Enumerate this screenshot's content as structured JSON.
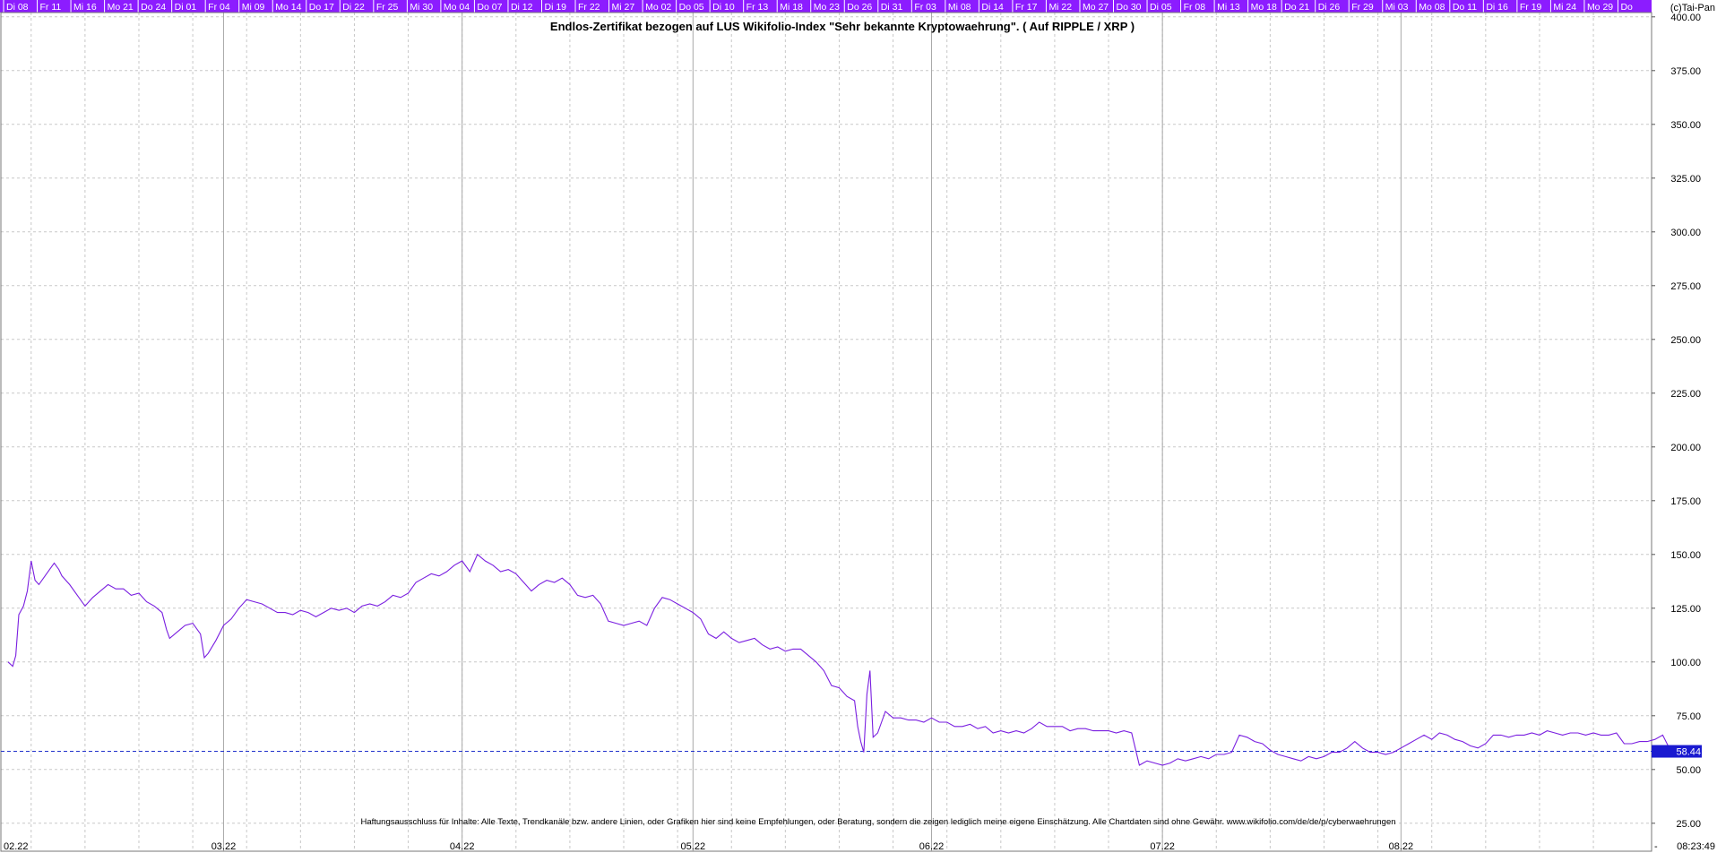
{
  "copyright": "(c)Tai-Pan",
  "timestamp": "08:23:49",
  "footer_dash": "-",
  "top_day_labels": [
    "Di 08",
    "Fr 11",
    "Mi 16",
    "Mo 21",
    "Do 24",
    "Di 01",
    "Fr 04",
    "Mi 09",
    "Mo 14",
    "Do 17",
    "Di 22",
    "Fr 25",
    "Mi 30",
    "Mo 04",
    "Do 07",
    "Di 12",
    "Di 19",
    "Fr 22",
    "Mi 27",
    "Mo 02",
    "Do 05",
    "Di 10",
    "Fr 13",
    "Mi 18",
    "Mo 23",
    "Do 26",
    "Di 31",
    "Fr 03",
    "Mi 08",
    "Di 14",
    "Fr 17",
    "Mi 22",
    "Mo 27",
    "Do 30",
    "Di 05",
    "Fr 08",
    "Mi 13",
    "Mo 18",
    "Do 21",
    "Di 26",
    "Fr 29",
    "Mi 03",
    "Mo 08",
    "Do 11",
    "Di 16",
    "Fr 19",
    "Mi 24",
    "Mo 29",
    "Do"
  ],
  "colors": {
    "series": "#7a1fe0",
    "header_bg": "#8c1cff",
    "header_text": "#ffffff",
    "current_line": "#2233cc",
    "price_box": "#1a1ad0",
    "grid": "#c8c8c8",
    "axis": "#555555"
  },
  "chart_data": {
    "type": "line",
    "title": "Endlos-Zertifikat bezogen auf LUS Wikifolio-Index \"Sehr bekannte Kryptowaehrung\". ( Auf RIPPLE / XRP )",
    "disclaimer": "Haftungsausschluss für Inhalte: Alle Texte, Trendkanäle bzw. andere Linien, oder Grafiken hier sind keine Empfehlungen, oder Beratung, sondern die zeigen lediglich meine eigene Einschätzung. Alle Chartdaten sind ohne Gewähr.  www.wikifolio.com/de/de/p/cyberwaehrungen",
    "y_ticks": [
      "400.00",
      "375.00",
      "350.00",
      "325.00",
      "300.00",
      "275.00",
      "250.00",
      "225.00",
      "200.00",
      "175.00",
      "150.00",
      "125.00",
      "100.00",
      "75.00",
      "50.00",
      "25.00"
    ],
    "ylim": [
      12,
      402
    ],
    "x_month_labels": [
      "02.22",
      "03.22",
      "04.22",
      "05.22",
      "06.22",
      "07.22",
      "08.22"
    ],
    "x_month_starts": [
      1,
      29,
      60,
      90,
      121,
      151,
      182
    ],
    "xlim": [
      1,
      212
    ],
    "x_unit": "day of year 2022",
    "grid": true,
    "current_value": "58.44",
    "current_value_num": 58.44,
    "series": [
      {
        "values": [
          [
            1,
            100
          ],
          [
            1.6,
            98
          ],
          [
            2,
            103
          ],
          [
            2.4,
            122
          ],
          [
            3,
            126
          ],
          [
            3.5,
            133
          ],
          [
            4,
            147
          ],
          [
            4.5,
            138
          ],
          [
            5,
            136
          ],
          [
            6,
            141
          ],
          [
            7,
            146
          ],
          [
            7.6,
            143
          ],
          [
            8,
            140
          ],
          [
            9,
            136
          ],
          [
            10,
            131
          ],
          [
            11,
            126
          ],
          [
            12,
            130
          ],
          [
            13,
            133
          ],
          [
            14,
            136
          ],
          [
            15,
            134
          ],
          [
            16,
            134
          ],
          [
            17,
            131
          ],
          [
            18,
            132
          ],
          [
            19,
            128
          ],
          [
            20,
            126
          ],
          [
            21,
            123
          ],
          [
            21.6,
            115
          ],
          [
            22,
            111
          ],
          [
            23,
            114
          ],
          [
            24,
            117
          ],
          [
            25,
            118
          ],
          [
            26,
            113
          ],
          [
            26.5,
            102
          ],
          [
            27,
            104
          ],
          [
            28,
            110
          ],
          [
            29,
            117
          ],
          [
            30,
            120
          ],
          [
            31,
            125
          ],
          [
            32,
            129
          ],
          [
            33,
            128
          ],
          [
            34,
            127
          ],
          [
            35,
            125
          ],
          [
            36,
            123
          ],
          [
            37,
            123
          ],
          [
            38,
            122
          ],
          [
            39,
            124
          ],
          [
            40,
            123
          ],
          [
            41,
            121
          ],
          [
            42,
            123
          ],
          [
            43,
            125
          ],
          [
            44,
            124
          ],
          [
            45,
            125
          ],
          [
            46,
            123
          ],
          [
            47,
            126
          ],
          [
            48,
            127
          ],
          [
            49,
            126
          ],
          [
            50,
            128
          ],
          [
            51,
            131
          ],
          [
            52,
            130
          ],
          [
            53,
            132
          ],
          [
            54,
            137
          ],
          [
            55,
            139
          ],
          [
            56,
            141
          ],
          [
            57,
            140
          ],
          [
            58,
            142
          ],
          [
            59,
            145
          ],
          [
            60,
            147
          ],
          [
            61,
            142
          ],
          [
            62,
            150
          ],
          [
            63,
            147
          ],
          [
            64,
            145
          ],
          [
            65,
            142
          ],
          [
            66,
            143
          ],
          [
            67,
            141
          ],
          [
            68,
            137
          ],
          [
            69,
            133
          ],
          [
            70,
            136
          ],
          [
            71,
            138
          ],
          [
            72,
            137
          ],
          [
            73,
            139
          ],
          [
            74,
            136
          ],
          [
            75,
            131
          ],
          [
            76,
            130
          ],
          [
            77,
            131
          ],
          [
            78,
            127
          ],
          [
            79,
            119
          ],
          [
            80,
            118
          ],
          [
            81,
            117
          ],
          [
            82,
            118
          ],
          [
            83,
            119
          ],
          [
            84,
            117
          ],
          [
            85,
            125
          ],
          [
            86,
            130
          ],
          [
            87,
            129
          ],
          [
            88,
            127
          ],
          [
            89,
            125
          ],
          [
            90,
            123
          ],
          [
            91,
            120
          ],
          [
            92,
            113
          ],
          [
            93,
            111
          ],
          [
            94,
            114
          ],
          [
            95,
            111
          ],
          [
            96,
            109
          ],
          [
            97,
            110
          ],
          [
            98,
            111
          ],
          [
            99,
            108
          ],
          [
            100,
            106
          ],
          [
            101,
            107
          ],
          [
            102,
            105
          ],
          [
            103,
            106
          ],
          [
            104,
            106
          ],
          [
            105,
            103
          ],
          [
            106,
            100
          ],
          [
            107,
            96
          ],
          [
            108,
            89
          ],
          [
            109,
            88
          ],
          [
            110,
            84
          ],
          [
            111,
            82
          ],
          [
            111.4,
            70
          ],
          [
            111.8,
            63
          ],
          [
            112.2,
            58
          ],
          [
            112.6,
            85
          ],
          [
            113,
            96
          ],
          [
            113.4,
            65
          ],
          [
            114,
            67
          ],
          [
            115,
            77
          ],
          [
            116,
            74
          ],
          [
            117,
            74
          ],
          [
            118,
            73
          ],
          [
            119,
            73
          ],
          [
            120,
            72
          ],
          [
            121,
            74
          ],
          [
            122,
            72
          ],
          [
            123,
            72
          ],
          [
            124,
            70
          ],
          [
            125,
            70
          ],
          [
            126,
            71
          ],
          [
            127,
            69
          ],
          [
            128,
            70
          ],
          [
            129,
            67
          ],
          [
            130,
            68
          ],
          [
            131,
            67
          ],
          [
            132,
            68
          ],
          [
            133,
            67
          ],
          [
            134,
            69
          ],
          [
            135,
            72
          ],
          [
            136,
            70
          ],
          [
            137,
            70
          ],
          [
            138,
            70
          ],
          [
            139,
            68
          ],
          [
            140,
            69
          ],
          [
            141,
            69
          ],
          [
            142,
            68
          ],
          [
            143,
            68
          ],
          [
            144,
            68
          ],
          [
            145,
            67
          ],
          [
            146,
            68
          ],
          [
            147,
            67
          ],
          [
            148,
            52
          ],
          [
            149,
            54
          ],
          [
            150,
            53
          ],
          [
            151,
            52
          ],
          [
            152,
            53
          ],
          [
            153,
            55
          ],
          [
            154,
            54
          ],
          [
            155,
            55
          ],
          [
            156,
            56
          ],
          [
            157,
            55
          ],
          [
            158,
            57
          ],
          [
            159,
            57
          ],
          [
            160,
            58
          ],
          [
            161,
            66
          ],
          [
            162,
            65
          ],
          [
            163,
            63
          ],
          [
            164,
            62
          ],
          [
            165,
            59
          ],
          [
            166,
            57
          ],
          [
            167,
            56
          ],
          [
            168,
            55
          ],
          [
            169,
            54
          ],
          [
            170,
            56
          ],
          [
            171,
            55
          ],
          [
            172,
            56
          ],
          [
            173,
            58
          ],
          [
            174,
            58
          ],
          [
            175,
            60
          ],
          [
            176,
            63
          ],
          [
            177,
            60
          ],
          [
            178,
            58
          ],
          [
            179,
            58
          ],
          [
            180,
            57
          ],
          [
            181,
            58
          ],
          [
            182,
            60
          ],
          [
            183,
            62
          ],
          [
            184,
            64
          ],
          [
            185,
            66
          ],
          [
            186,
            64
          ],
          [
            187,
            67
          ],
          [
            188,
            66
          ],
          [
            189,
            64
          ],
          [
            190,
            63
          ],
          [
            191,
            61
          ],
          [
            192,
            60
          ],
          [
            193,
            62
          ],
          [
            194,
            66
          ],
          [
            195,
            66
          ],
          [
            196,
            65
          ],
          [
            197,
            66
          ],
          [
            198,
            66
          ],
          [
            199,
            67
          ],
          [
            200,
            66
          ],
          [
            201,
            68
          ],
          [
            202,
            67
          ],
          [
            203,
            66
          ],
          [
            204,
            67
          ],
          [
            205,
            67
          ],
          [
            206,
            66
          ],
          [
            207,
            67
          ],
          [
            208,
            66
          ],
          [
            209,
            66
          ],
          [
            210,
            67
          ],
          [
            211,
            62
          ],
          [
            212,
            62
          ],
          [
            213,
            63
          ],
          [
            214,
            63
          ],
          [
            215,
            64
          ],
          [
            216,
            66
          ],
          [
            217,
            59
          ],
          [
            218,
            59
          ],
          [
            219,
            59
          ],
          [
            220,
            58
          ]
        ]
      }
    ]
  }
}
